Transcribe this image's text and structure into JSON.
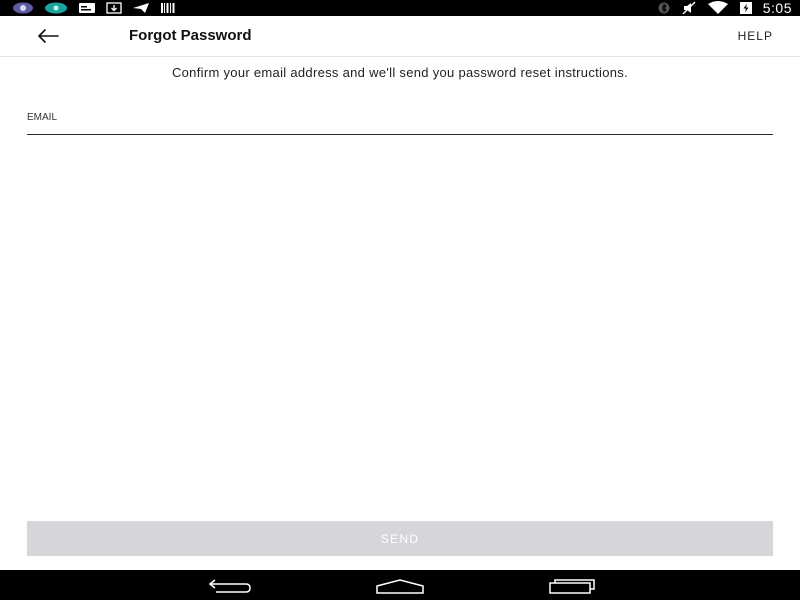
{
  "status_bar": {
    "time": "5:05",
    "notification_icons": [
      "app-icon",
      "app-icon",
      "message-icon",
      "download-icon",
      "send-icon",
      "barcode-icon"
    ],
    "system_icons": [
      "bluetooth-icon",
      "mute-icon",
      "wifi-icon",
      "battery-icon"
    ]
  },
  "app_bar": {
    "back_icon": "arrow-left-icon",
    "title": "Forgot Password",
    "help_label": "HELP"
  },
  "form": {
    "instructions": "Confirm your email address and we'll send you password reset instructions.",
    "email_label": "EMAIL",
    "email_value": "",
    "send_label": "SEND",
    "send_button_color": "#d4d6da"
  },
  "nav_bar": {
    "buttons": [
      "back-nav-icon",
      "home-nav-icon",
      "recents-nav-icon"
    ]
  }
}
